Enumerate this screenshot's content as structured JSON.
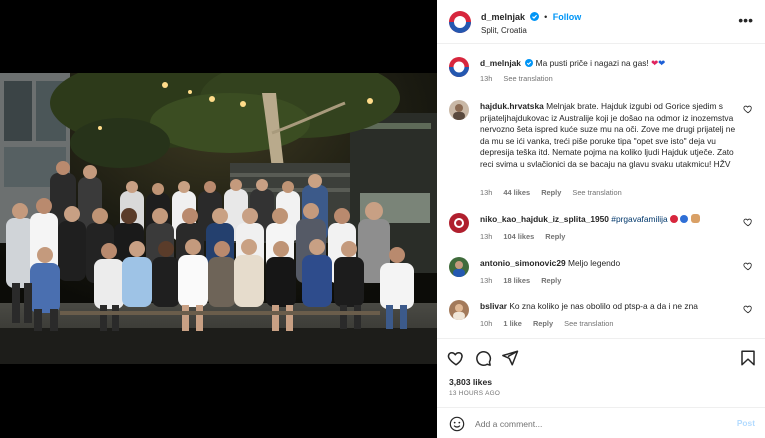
{
  "post": {
    "username": "d_melnjak",
    "follow_label": "Follow",
    "location": "Split, Croatia",
    "more_icon": "more-horizontal-icon"
  },
  "caption": {
    "username": "d_melnjak",
    "text": "Ma pusti priče i nagazi na gas!",
    "emoji": [
      "red-heart",
      "blue-heart"
    ],
    "age": "13h",
    "see_translation": "See translation"
  },
  "comments": [
    {
      "username": "hajduk.hrvatska",
      "text": "Melnjak brate. Hajduk izgubi od Gorice sjedim s prijateljhajdukovac iz Australije koji je došao na odmor iz inozemstva nervozno šeta ispred kuće suze mu na oči. Zove me drugi prijatelj ne da mu se ići vanka, treći piše poruke tipa \"opet sve isto\" deja vu depresija teška itd. Nemate pojma na koliko ljudi Hajduk utječe. Zato reci svima u svlačionici da se bacaju na glavu svaku utakmicu! HŽV",
      "age": "13h",
      "likes": "44 likes",
      "reply": "Reply",
      "see_translation": "See translation"
    },
    {
      "username": "niko_kao_hajduk_iz_splita_1950",
      "hashtag": "#prgavafamilija",
      "age": "13h",
      "likes": "104 likes",
      "reply": "Reply"
    },
    {
      "username": "antonio_simonovic29",
      "text": "Meljo legendo",
      "age": "13h",
      "likes": "18 likes",
      "reply": "Reply"
    },
    {
      "username": "bslivar",
      "text": "Ko zna koliko je nas obolilo od ptsp-a a da i ne zna",
      "age": "10h",
      "likes": "1 like",
      "reply": "Reply",
      "see_translation": "See translation"
    }
  ],
  "actions": {
    "likes": "3,803 likes",
    "time": "13 HOURS AGO",
    "comment_placeholder": "Add a comment...",
    "post_label": "Post"
  },
  "colors": {
    "accent": "#0095f6",
    "heart_red": "#ed4956",
    "secondary_text": "#737373"
  }
}
